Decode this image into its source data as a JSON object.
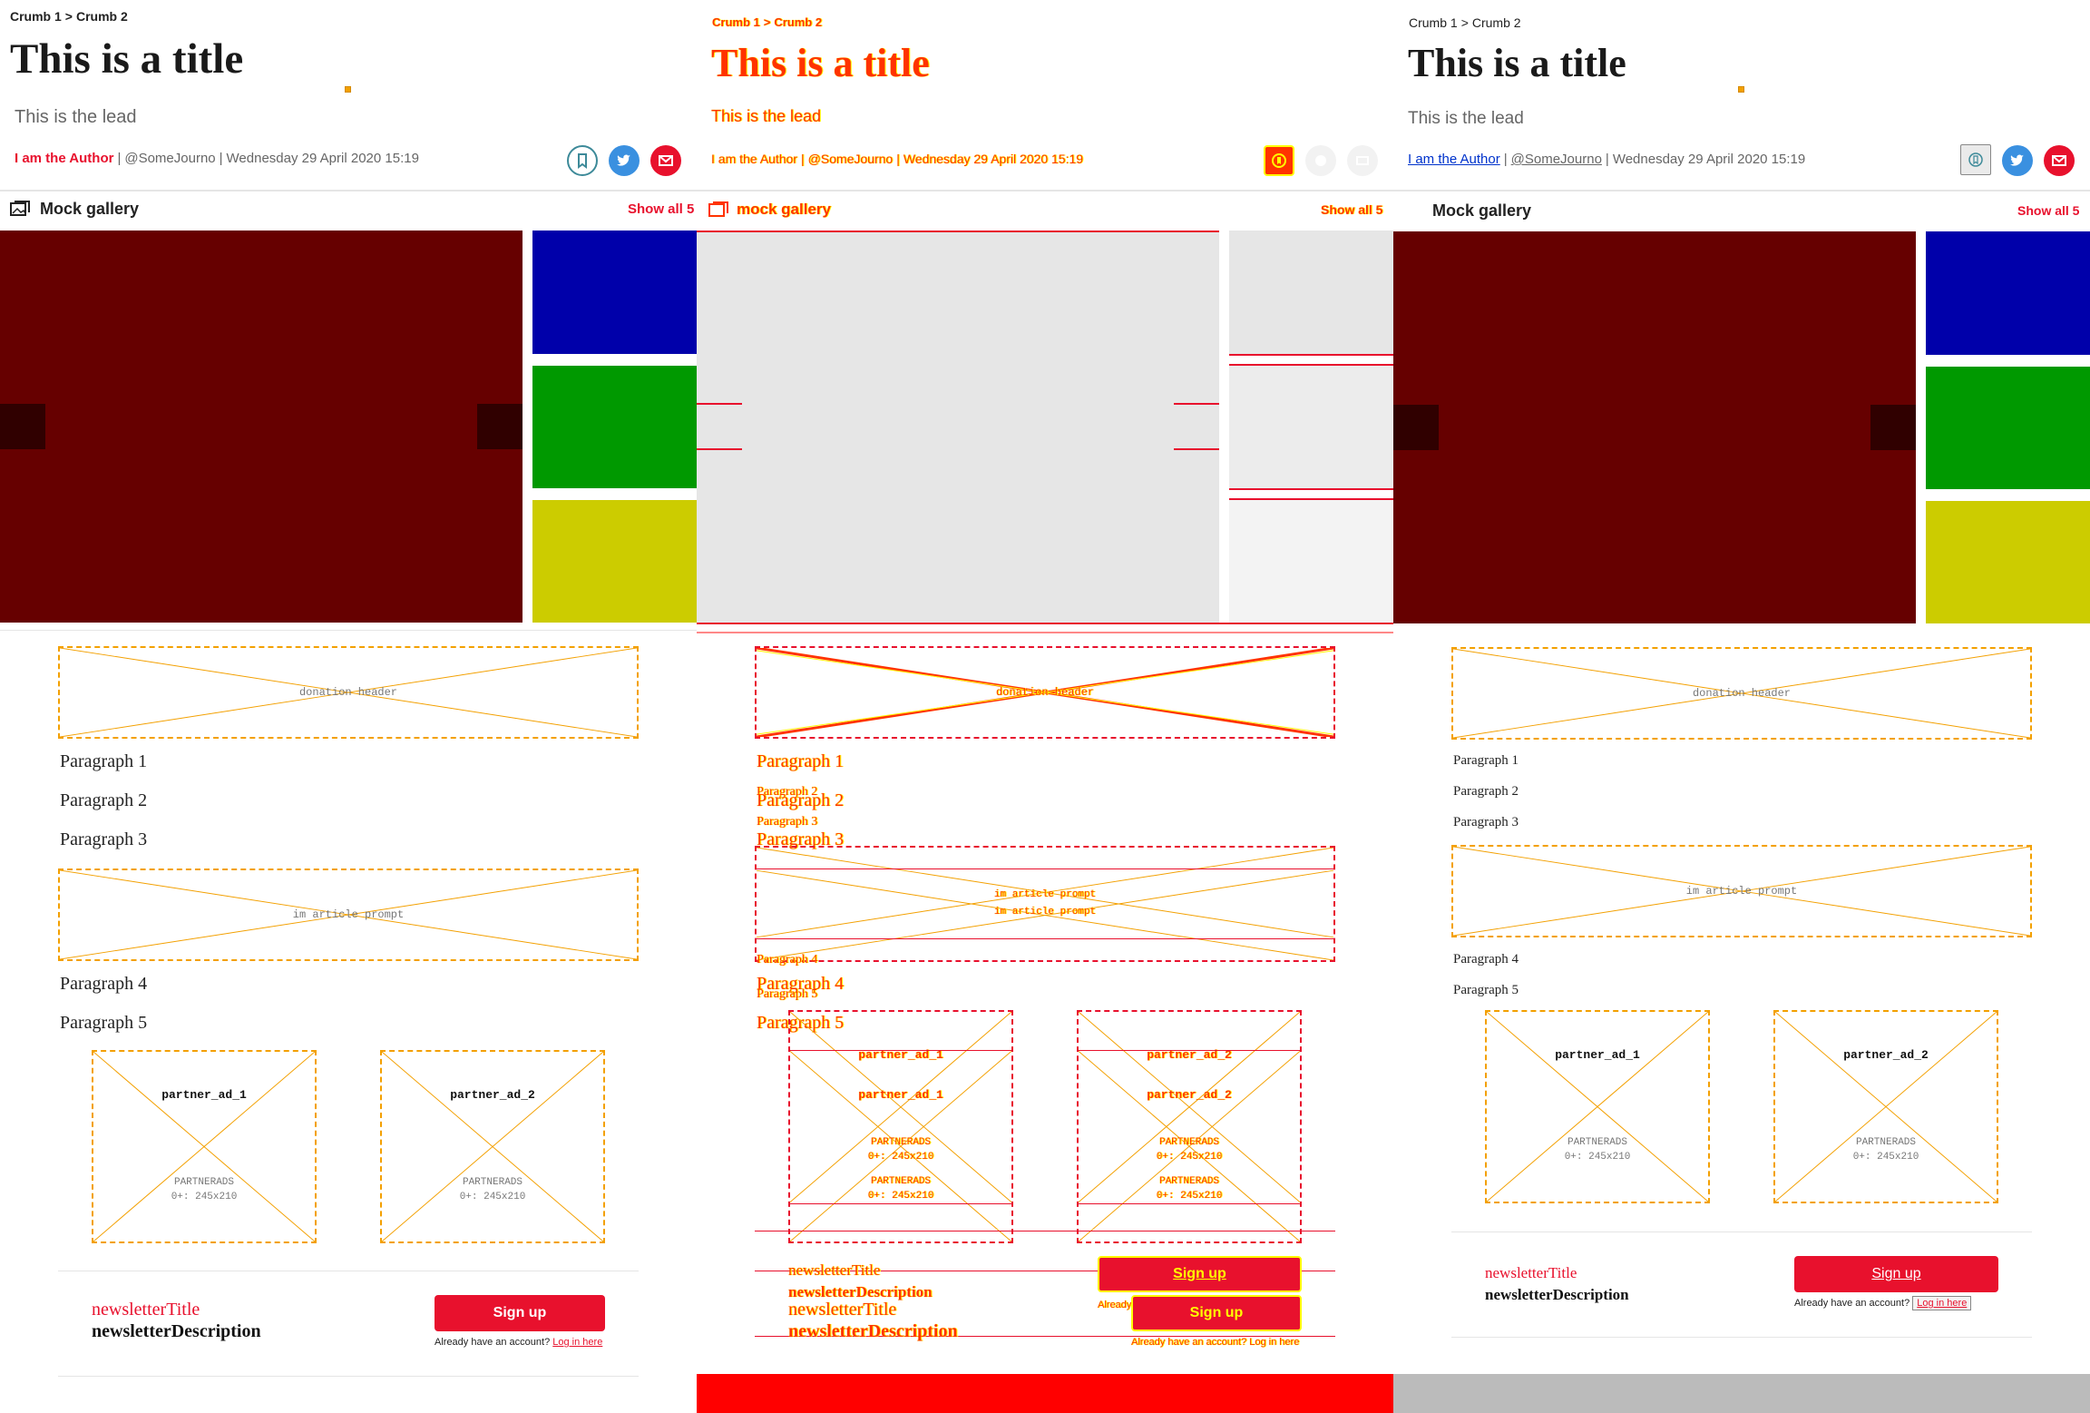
{
  "crumbs": [
    "Crumb 1",
    "Crumb 2"
  ],
  "crumb_separator": ">",
  "title": "This is a title",
  "lead": "This is the lead",
  "byline": {
    "author": "I am the Author",
    "handle": "@SomeJourno",
    "date": "Wednesday 29 April 2020 15:19"
  },
  "share_icons": [
    "bookmark-icon",
    "twitter-icon",
    "email-icon"
  ],
  "gallery": {
    "title": "Mock gallery",
    "diff_title": "mock gallery",
    "show_all": "Show all 5",
    "diff_show_all": "Show all 5",
    "main_color": "#660000",
    "thumb_colors": [
      "#0000aa",
      "#009900",
      "#cccc00"
    ]
  },
  "placeholders": {
    "donation_header": "donation header",
    "in_article_prompt": "im article prompt"
  },
  "paragraphs": [
    "Paragraph 1",
    "Paragraph 2",
    "Paragraph 3",
    "Paragraph 4",
    "Paragraph 5"
  ],
  "partner_ads": [
    {
      "name": "partner_ad_1",
      "meta_1": "PARTNERADS",
      "meta_2": "0+: 245x210"
    },
    {
      "name": "partner_ad_2",
      "meta_1": "PARTNERADS",
      "meta_2": "0+: 245x210"
    }
  ],
  "newsletter": {
    "title": "newsletterTitle",
    "description": "newsletterDescription",
    "signup": "Sign up",
    "already": "Already have an account?",
    "login": "Log in here"
  },
  "colors": {
    "accent": "#e8112d",
    "placeholder": "#f3a000",
    "diff_bar": "#ff0000",
    "grey_bar": "#bbbbbb"
  }
}
